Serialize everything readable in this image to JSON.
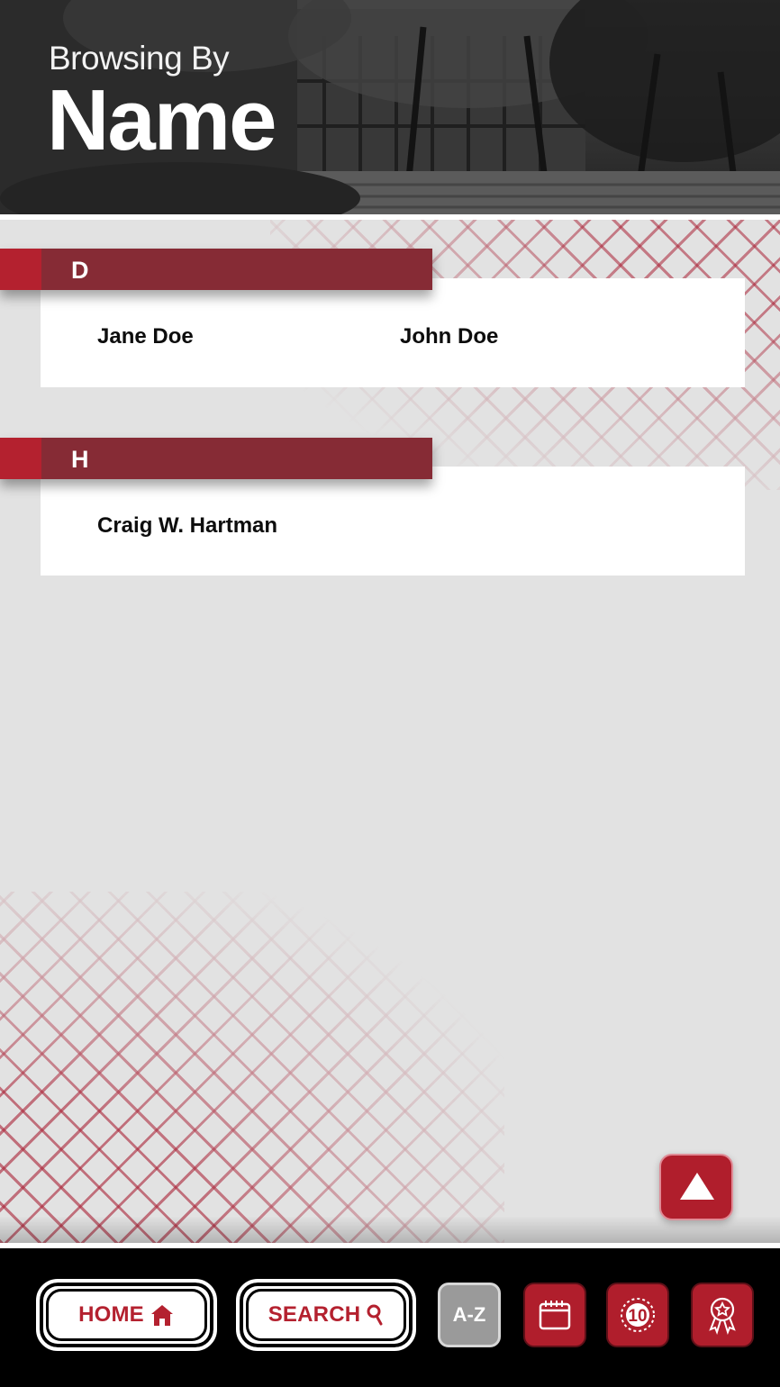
{
  "header": {
    "subtitle": "Browsing By",
    "title": "Name"
  },
  "sections": [
    {
      "letter": "D",
      "names": [
        "Jane Doe",
        "John Doe"
      ]
    },
    {
      "letter": "H",
      "names": [
        "Craig W. Hartman"
      ]
    }
  ],
  "scroll_top": {
    "icon": "triangle-up-icon"
  },
  "nav": {
    "home": {
      "label": "HOME",
      "icon": "home-icon"
    },
    "search": {
      "label": "SEARCH",
      "icon": "search-icon"
    },
    "az": {
      "label": "A-Z"
    },
    "calendar": {
      "icon": "calendar-icon"
    },
    "ten": {
      "label": "10",
      "icon": "badge-10-icon"
    },
    "award": {
      "icon": "award-ribbon-icon"
    }
  },
  "colors": {
    "brand_red": "#b4212f",
    "bar_red": "#862b35",
    "background": "#e2e2e2",
    "nav_background": "#000000"
  }
}
